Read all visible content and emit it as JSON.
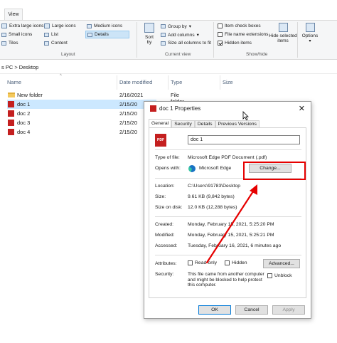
{
  "ribbon": {
    "tab": "View",
    "layout": {
      "items": [
        "Extra large icons",
        "Large icons",
        "Medium icons",
        "Small icons",
        "List",
        "Details",
        "Tiles",
        "Content"
      ],
      "label": "Layout"
    },
    "current_view": {
      "sort_label": "Sort\nby",
      "group_by": "Group by",
      "add_columns": "Add columns",
      "size_columns": "Size all columns to fit",
      "label": "Current view"
    },
    "show_hide": {
      "item_check_boxes": "Item check boxes",
      "file_name_extensions": "File name extensions",
      "hidden_items": "Hidden items",
      "hide_selected": "Hide selected\nitems",
      "label": "Show/hide"
    },
    "options": "Options"
  },
  "address": {
    "path": "s PC  >  Desktop"
  },
  "file_list": {
    "columns": [
      "Name",
      "Date modified",
      "Type",
      "Size"
    ],
    "rows": [
      {
        "name": "New folder",
        "date": "2/16/2021 8:51 PM",
        "type": "File folder",
        "kind": "folder"
      },
      {
        "name": "doc 1",
        "date": "2/15/20",
        "type": "",
        "kind": "pdf"
      },
      {
        "name": "doc 2",
        "date": "2/15/20",
        "type": "",
        "kind": "pdf"
      },
      {
        "name": "doc 3",
        "date": "2/15/20",
        "type": "",
        "kind": "pdf"
      },
      {
        "name": "doc 4",
        "date": "2/15/20",
        "type": "",
        "kind": "pdf"
      }
    ]
  },
  "dialog": {
    "title": "doc 1 Properties",
    "close": "✕",
    "tabs": [
      "General",
      "Security",
      "Details",
      "Previous Versions"
    ],
    "file_name": "doc 1",
    "type_of_file_label": "Type of file:",
    "type_of_file": "Microsoft Edge PDF Document (.pdf)",
    "opens_with_label": "Opens with:",
    "opens_with": "Microsoft Edge",
    "change_button": "Change...",
    "location_label": "Location:",
    "location": "C:\\Users\\91783\\Desktop",
    "size_label": "Size:",
    "size": "9.61 KB (9,842 bytes)",
    "size_on_disk_label": "Size on disk:",
    "size_on_disk": "12.0 KB (12,288 bytes)",
    "created_label": "Created:",
    "created": "Monday, February 15, 2021, 5:25:20 PM",
    "modified_label": "Modified:",
    "modified": "Monday, February 15, 2021, 5:25:21 PM",
    "accessed_label": "Accessed:",
    "accessed": "Tuesday, February 16, 2021, 6 minutes ago",
    "attributes_label": "Attributes:",
    "read_only": "Read-only",
    "hidden": "Hidden",
    "advanced_button": "Advanced...",
    "security_label": "Security:",
    "security_text": "This file came from another computer and might be blocked to help protect this computer.",
    "unblock": "Unblock",
    "ok_button": "OK",
    "cancel_button": "Cancel",
    "apply_button": "Apply",
    "pdf_icon_text": "PDF"
  },
  "colors": {
    "accent": "#0078d7",
    "highlight": "#e60000",
    "selection": "#cce8ff"
  }
}
